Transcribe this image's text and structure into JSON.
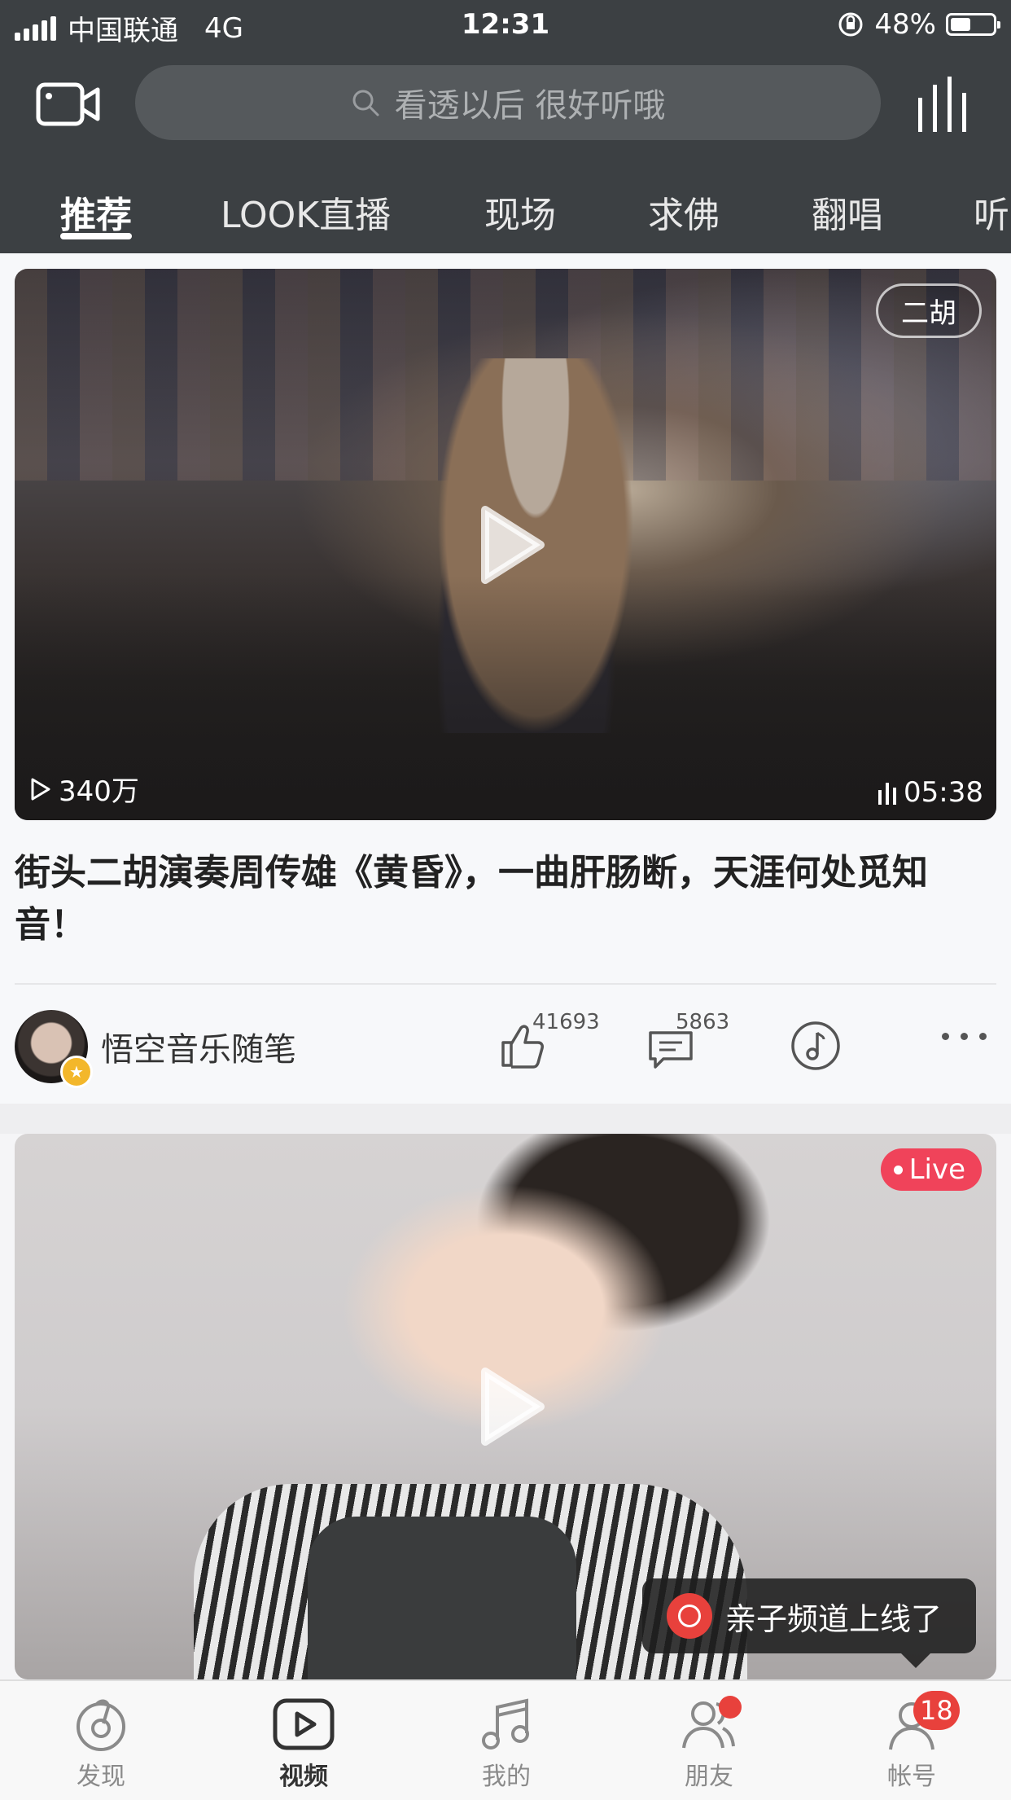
{
  "status_bar": {
    "carrier": "中国联通",
    "network": "4G",
    "time": "12:31",
    "battery": "48%",
    "battery_level": 0.48
  },
  "header": {
    "search_placeholder": "看透以后 很好听哦",
    "tabs": [
      {
        "label": "推荐",
        "active": true
      },
      {
        "label": "LOOK直播",
        "active": false
      },
      {
        "label": "现场",
        "active": false
      },
      {
        "label": "求佛",
        "active": false
      },
      {
        "label": "翻唱",
        "active": false
      },
      {
        "label": "听",
        "active": false
      }
    ]
  },
  "feed": {
    "card1": {
      "tag": "二胡",
      "views": "340万",
      "duration": "05:38",
      "title": "街头二胡演奏周传雄《黄昏》，一曲肝肠断，天涯何处觅知音！",
      "author": "悟空音乐随笔",
      "likes": "41693",
      "comments": "5863"
    },
    "card2": {
      "badge": "Live"
    },
    "toast": "亲子频道上线了"
  },
  "bottom_nav": [
    {
      "label": "发现",
      "icon": "discover-icon"
    },
    {
      "label": "视频",
      "icon": "video-play-icon",
      "active": true
    },
    {
      "label": "我的",
      "icon": "music-note-icon"
    },
    {
      "label": "朋友",
      "icon": "friends-icon",
      "dot": true
    },
    {
      "label": "帐号",
      "icon": "account-icon",
      "badge": "18"
    }
  ],
  "colors": {
    "header_bg": "#3c4043",
    "accent_red": "#e8413c",
    "live_red": "#f0435a"
  }
}
